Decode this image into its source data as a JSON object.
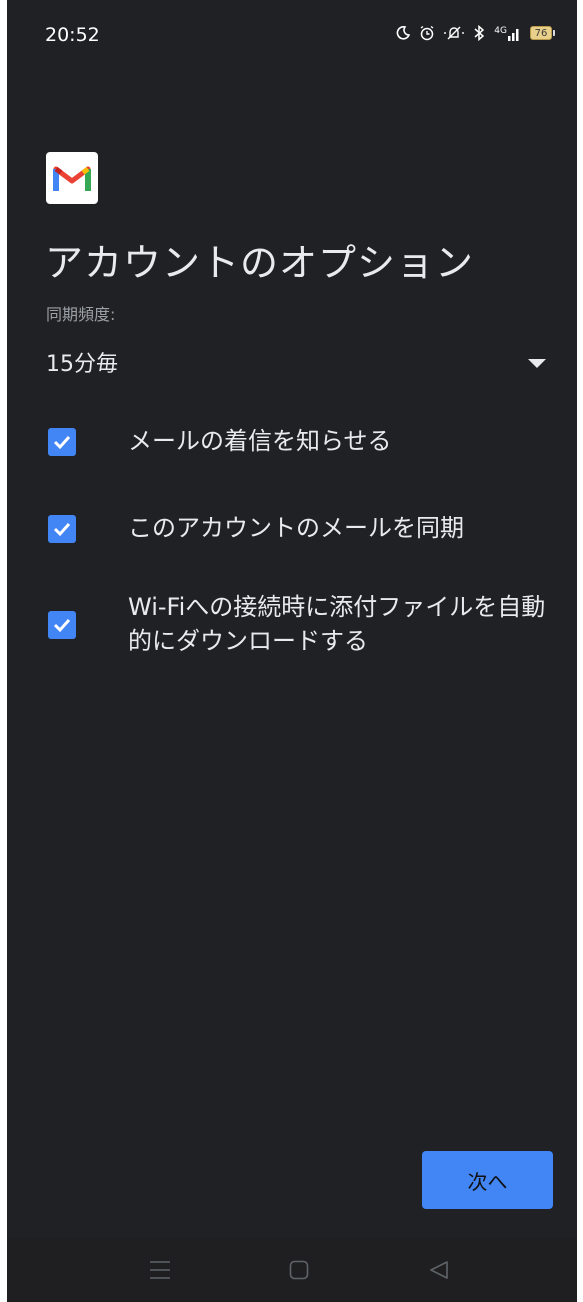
{
  "status_bar": {
    "time": "20:52",
    "network": "4G",
    "battery": "76",
    "icons": [
      "moon-icon",
      "alarm-icon",
      "mute-icon",
      "bluetooth-icon",
      "signal-icon",
      "battery-icon"
    ]
  },
  "app": {
    "logo": "gmail-logo",
    "title": "アカウントのオプション"
  },
  "sync": {
    "label": "同期頻度:",
    "value": "15分毎"
  },
  "options": [
    {
      "label": "メールの着信を知らせる",
      "checked": true
    },
    {
      "label": "このアカウントのメールを同期",
      "checked": true
    },
    {
      "label": "Wi-Fiへの接続時に添付ファイルを自動的にダウンロードする",
      "checked": true
    }
  ],
  "actions": {
    "next_label": "次へ"
  },
  "navigation": {
    "items": [
      "menu-icon",
      "home-icon",
      "back-icon"
    ]
  },
  "colors": {
    "background": "#202124",
    "accent": "#4285f4",
    "text": "#e8eaed",
    "secondary_text": "#9aa0a6"
  }
}
